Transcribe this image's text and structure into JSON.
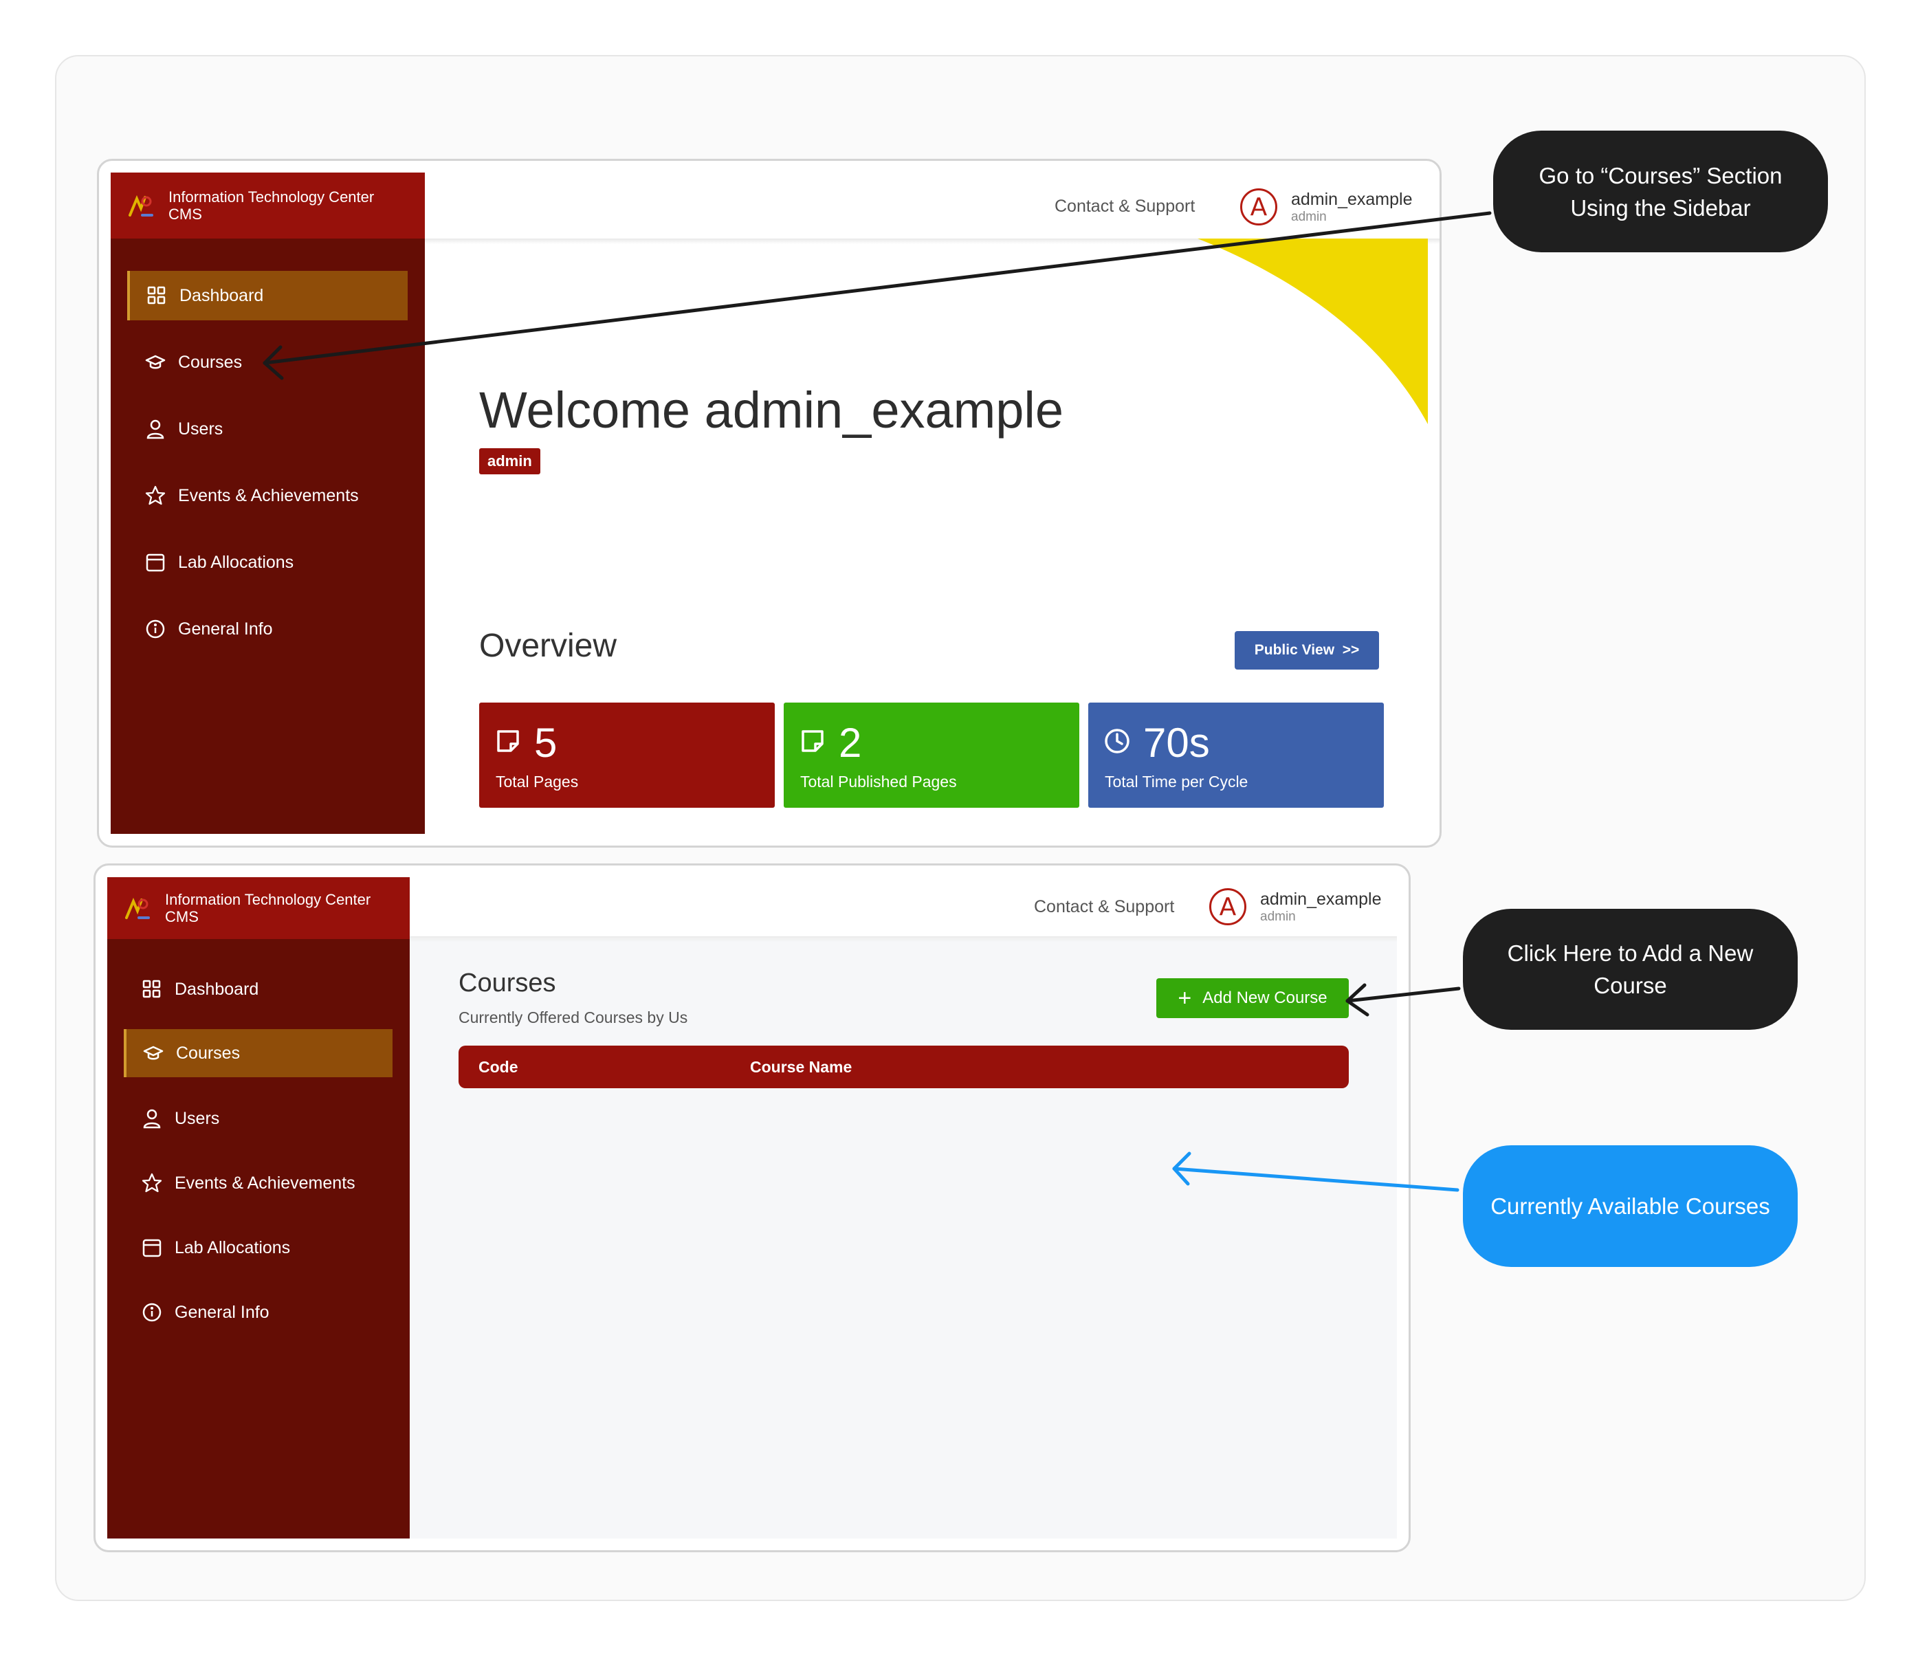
{
  "screen1": {
    "brand": {
      "line1": "Information Technology Center",
      "line2": "CMS"
    },
    "nav": [
      {
        "label": "Dashboard",
        "icon": "dashboard-icon",
        "active": true
      },
      {
        "label": "Courses",
        "icon": "graduation-cap-icon",
        "active": false
      },
      {
        "label": "Users",
        "icon": "user-icon",
        "active": false
      },
      {
        "label": "Events & Achievements",
        "icon": "star-icon",
        "active": false
      },
      {
        "label": "Lab Allocations",
        "icon": "calendar-icon",
        "active": false
      },
      {
        "label": "General Info",
        "icon": "info-icon",
        "active": false
      }
    ],
    "topbar": {
      "contact": "Contact & Support",
      "avatar_letter": "A",
      "user_name": "admin_example",
      "user_role": "admin"
    },
    "welcome": "Welcome admin_example",
    "role_badge": "admin",
    "overview": {
      "title": "Overview",
      "public_view": "Public View  >>"
    },
    "stats": [
      {
        "value": "5",
        "label": "Total Pages",
        "icon": "page-icon",
        "color": "#97110b"
      },
      {
        "value": "2",
        "label": "Total Published Pages",
        "icon": "page-icon",
        "color": "#38b00a"
      },
      {
        "value": "70s",
        "label": "Total Time per Cycle",
        "icon": "clock-icon",
        "color": "#3d61ab"
      }
    ]
  },
  "screen2": {
    "brand": {
      "line1": "Information Technology Center",
      "line2": "CMS"
    },
    "nav": [
      {
        "label": "Dashboard",
        "icon": "dashboard-icon",
        "active": false
      },
      {
        "label": "Courses",
        "icon": "graduation-cap-icon",
        "active": true
      },
      {
        "label": "Users",
        "icon": "user-icon",
        "active": false
      },
      {
        "label": "Events & Achievements",
        "icon": "star-icon",
        "active": false
      },
      {
        "label": "Lab Allocations",
        "icon": "calendar-icon",
        "active": false
      },
      {
        "label": "General Info",
        "icon": "info-icon",
        "active": false
      }
    ],
    "topbar": {
      "contact": "Contact & Support",
      "avatar_letter": "A",
      "user_name": "admin_example",
      "user_role": "admin"
    },
    "courses": {
      "title": "Courses",
      "subtitle": "Currently Offered Courses by Us",
      "add_button": "Add New Course",
      "columns": [
        "Code",
        "Course Name"
      ],
      "rows": []
    }
  },
  "callouts": {
    "sidebar_hint": {
      "line1": "Go to “Courses” Section",
      "line2": "Using the Sidebar"
    },
    "add_hint": {
      "line1": "Click Here to Add a New",
      "line2": "Course"
    },
    "available_hint": {
      "text": "Currently Available Courses"
    }
  },
  "colors": {
    "sidebar": "#640d05",
    "brand_bar": "#97110b",
    "active_nav": "#8f4d09",
    "accent_yellow": "#f0d800",
    "public_view": "#3b5fa8",
    "add_button": "#35a80a",
    "callout_dark": "#1f1f1f",
    "callout_blue": "#1896f5"
  }
}
